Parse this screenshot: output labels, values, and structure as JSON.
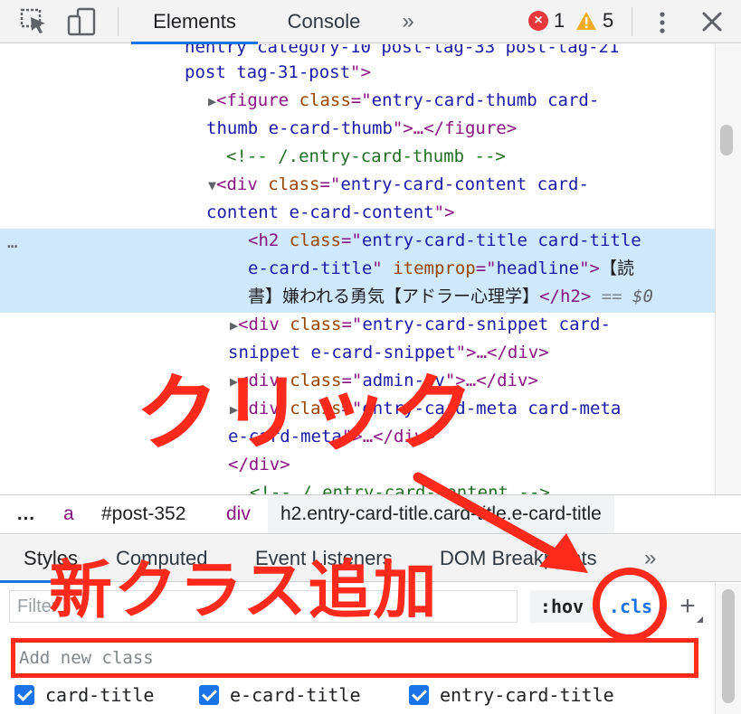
{
  "toolbar": {
    "tabs": {
      "elements": "Elements",
      "console": "Console"
    },
    "more_tabs": "»",
    "error_icon": "×",
    "error_count": "1",
    "warning_count": "5"
  },
  "dom_lines": {
    "l0": {
      "text": "nentry category-10 post-tag-33 post-tag-21"
    },
    "l1": {
      "val": "post tag-31-post",
      "close": "\">"
    },
    "l2": {
      "tag_open": "<figure",
      "attr": "class",
      "val1": "entry-card-thumb card-"
    },
    "l3": {
      "val": "thumb e-card-thumb",
      "rest": "…</figure>"
    },
    "l4": {
      "comment": "<!-- /.entry-card-thumb -->"
    },
    "l5": {
      "tag_open": "<div",
      "attr": "class",
      "val1": "entry-card-content card-"
    },
    "l6": {
      "val": "content e-card-content"
    },
    "l7": {
      "tag_open": "<h2",
      "attr": "class",
      "val1": "entry-card-title card-title"
    },
    "l8": {
      "val": "e-card-title",
      "attr2": "itemprop",
      "val2": "headline",
      "text": "【読"
    },
    "l9": {
      "text": "書】嫌われる勇気【アドラー心理学】",
      "tag_close": "</h2>",
      "eq": "== ",
      "dollar": "$0"
    },
    "l10": {
      "tag_open": "<div",
      "attr": "class",
      "val1": "entry-card-snippet card-"
    },
    "l11": {
      "val": "snippet e-card-snippet",
      "rest": "…</div>"
    },
    "l12": {
      "tag_open": "<div",
      "attr": "class",
      "val1": "admin-pv",
      "rest": "…</div>"
    },
    "l13": {
      "tag_open": "<div",
      "attr": "class",
      "val1": "entry-card-meta card-meta"
    },
    "l14": {
      "val": "e-card-meta",
      "rest": "…</div>"
    },
    "l15": {
      "tag_close": "</div>"
    },
    "l16": {
      "comment": "<!-- /.entry-card-content -->"
    }
  },
  "selection_ellipsis": "…",
  "breadcrumb": {
    "dots": "…",
    "items": [
      "a",
      "#post-352",
      "div",
      "h2.entry-card-title.card-title.e-card-title"
    ]
  },
  "lower_tabs": {
    "styles": "Styles",
    "computed": "Computed",
    "event_listeners": "Event Listeners",
    "dom_breakpoints": "DOM Breakpoints",
    "more": "»"
  },
  "filter": {
    "placeholder": "Filter",
    "hov": ":hov",
    "cls": ".cls",
    "plus": "+"
  },
  "add_class": {
    "placeholder": "Add new class"
  },
  "classes": [
    "card-title",
    "e-card-title",
    "entry-card-title"
  ],
  "annotations": {
    "click": "クリック",
    "new_class": "新クラス追加"
  },
  "colors": {
    "annotation_red": "#ff2a1c",
    "accent_blue": "#1a73e8",
    "selection_bg": "#cfe8fc"
  },
  "icons": [
    "inspect-element-icon",
    "device-toolbar-icon",
    "error-icon",
    "warning-icon",
    "kebab-menu-icon",
    "close-icon",
    "expand-triangle-icon",
    "collapse-triangle-icon",
    "checkbox-checked-icon"
  ]
}
